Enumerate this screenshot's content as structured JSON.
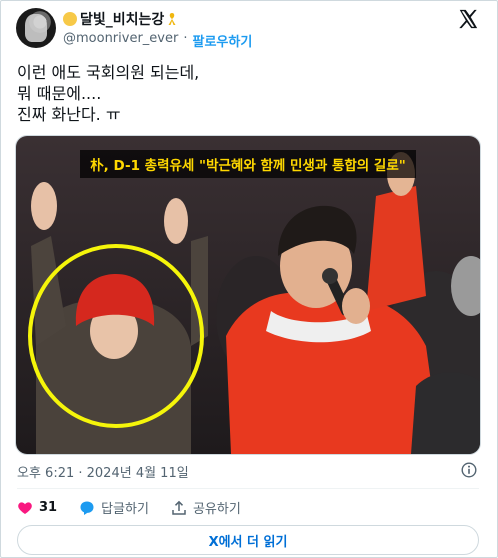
{
  "author": {
    "display_name": "달빛_비치는강",
    "handle": "@moonriver_ever",
    "separator": "·",
    "follow_label": "팔로우하기"
  },
  "tweet": {
    "text": "이런 애도 국회의원 되는데,\n뭐 때문에....\n진짜 화난다. ㅠ",
    "image_caption": "朴, D-1 총력유세 \"박근혜와 함께 민생과 통합의 길로\"",
    "timestamp": "오후 6:21 · 2024년 4월 11일"
  },
  "actions": {
    "like_count": "31",
    "reply_label": "답글하기",
    "share_label": "공유하기"
  },
  "read_more_label": "X에서 더 읽기",
  "colors": {
    "accent": "#1d9bf0",
    "like": "#f91880",
    "highlight_circle": "#f5f50a",
    "caption_text": "#ffd800"
  },
  "icons": [
    "moon-emoji-icon",
    "yellow-ribbon-icon",
    "x-logo-icon",
    "info-icon",
    "heart-icon",
    "reply-bubble-icon",
    "share-icon"
  ]
}
